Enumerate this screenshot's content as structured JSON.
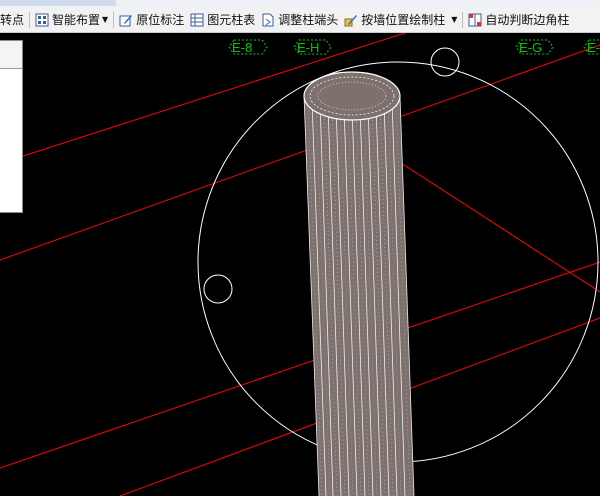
{
  "toolbar": {
    "items": [
      {
        "label": "转点",
        "icon": "point-icon"
      },
      {
        "label": "智能布置",
        "icon": "smart-layout-icon",
        "dropdown": true
      },
      {
        "label": "原位标注",
        "icon": "in-place-annotation-icon"
      },
      {
        "label": "图元柱表",
        "icon": "element-column-table-icon"
      },
      {
        "label": "调整柱端头",
        "icon": "adjust-column-end-icon"
      },
      {
        "label": "按墙位置绘制柱",
        "icon": "draw-column-by-wall-icon",
        "dropdown": true
      },
      {
        "label": "自动判断边角柱",
        "icon": "auto-corner-column-icon"
      }
    ]
  },
  "axes": {
    "labels": [
      "E-8",
      "E-H",
      "E-G",
      "E-"
    ]
  },
  "colors": {
    "toolbar_bg": "#f2f2f2",
    "canvas_bg": "#000000",
    "axis_line": "#ff0000",
    "axis_label": "#00c800",
    "wire": "#ffffff"
  }
}
